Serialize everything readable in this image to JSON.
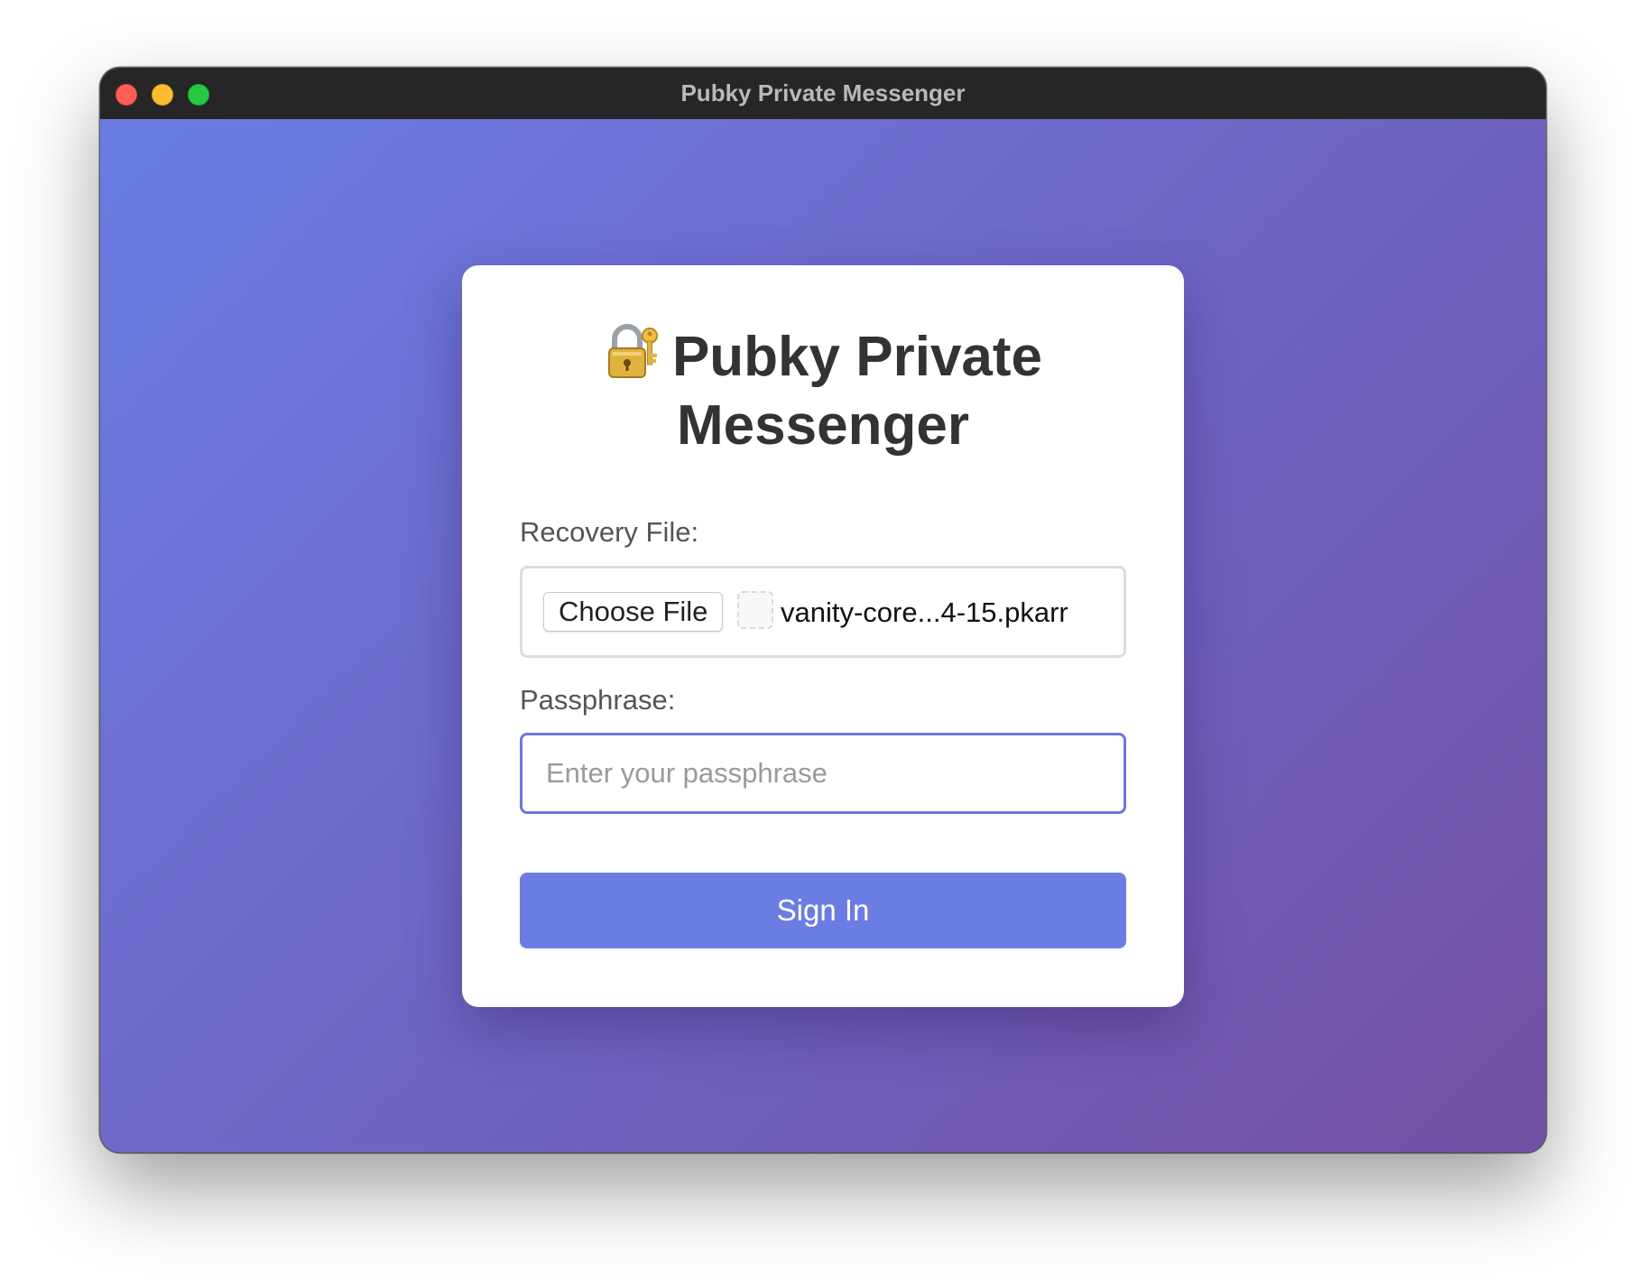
{
  "window": {
    "title": "Pubky Private Messenger"
  },
  "card": {
    "title_icon": "lock-with-key-icon",
    "title": "Pubky Private Messenger"
  },
  "recovery": {
    "label": "Recovery File:",
    "choose_button": "Choose File",
    "file_name": "vanity-core...4-15.pkarr"
  },
  "passphrase": {
    "label": "Passphrase:",
    "placeholder": "Enter your passphrase",
    "value": ""
  },
  "sign_in": {
    "label": "Sign In"
  },
  "colors": {
    "gradient_start": "#6a7de3",
    "gradient_end": "#7250a3",
    "accent": "#6b7de3",
    "title_text": "#333333"
  }
}
